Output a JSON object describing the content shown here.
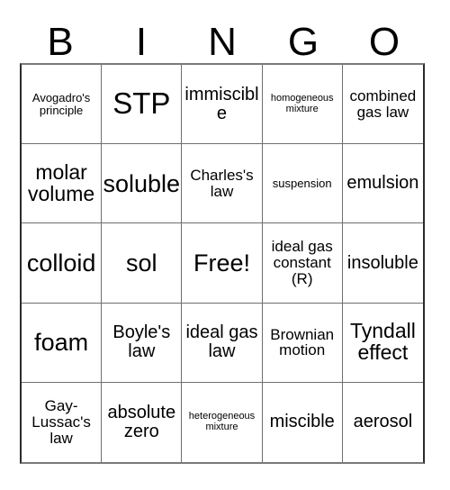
{
  "card": {
    "title_letters": [
      "B",
      "I",
      "N",
      "G",
      "O"
    ],
    "free_space_label": "Free!",
    "colors": {
      "background": "#ffffff",
      "text": "#000000",
      "grid_line": "#6f6f6f",
      "outer_border": "#2b2b2b"
    },
    "rows": [
      [
        {
          "text": "Avogadro's principle",
          "size": "s"
        },
        {
          "text": "STP",
          "size": "huge"
        },
        {
          "text": "immiscible",
          "size": "l"
        },
        {
          "text": "homogeneous mixture",
          "size": "xs"
        },
        {
          "text": "combined gas law",
          "size": "m"
        }
      ],
      [
        {
          "text": "molar volume",
          "size": "xl"
        },
        {
          "text": "soluble",
          "size": "xxl"
        },
        {
          "text": "Charles's law",
          "size": "m"
        },
        {
          "text": "suspension",
          "size": "s"
        },
        {
          "text": "emulsion",
          "size": "l"
        }
      ],
      [
        {
          "text": "colloid",
          "size": "xxl"
        },
        {
          "text": "sol",
          "size": "xxl"
        },
        {
          "text": "Free!",
          "size": "xxl"
        },
        {
          "text": "ideal gas constant (R)",
          "size": "m"
        },
        {
          "text": "insoluble",
          "size": "l"
        }
      ],
      [
        {
          "text": "foam",
          "size": "xxl"
        },
        {
          "text": "Boyle's law",
          "size": "l"
        },
        {
          "text": "ideal gas law",
          "size": "l"
        },
        {
          "text": "Brownian motion",
          "size": "m"
        },
        {
          "text": "Tyndall effect",
          "size": "xl"
        }
      ],
      [
        {
          "text": "Gay-Lussac's law",
          "size": "m"
        },
        {
          "text": "absolute zero",
          "size": "l"
        },
        {
          "text": "heterogeneous mixture",
          "size": "xs"
        },
        {
          "text": "miscible",
          "size": "l"
        },
        {
          "text": "aerosol",
          "size": "l"
        }
      ]
    ]
  }
}
